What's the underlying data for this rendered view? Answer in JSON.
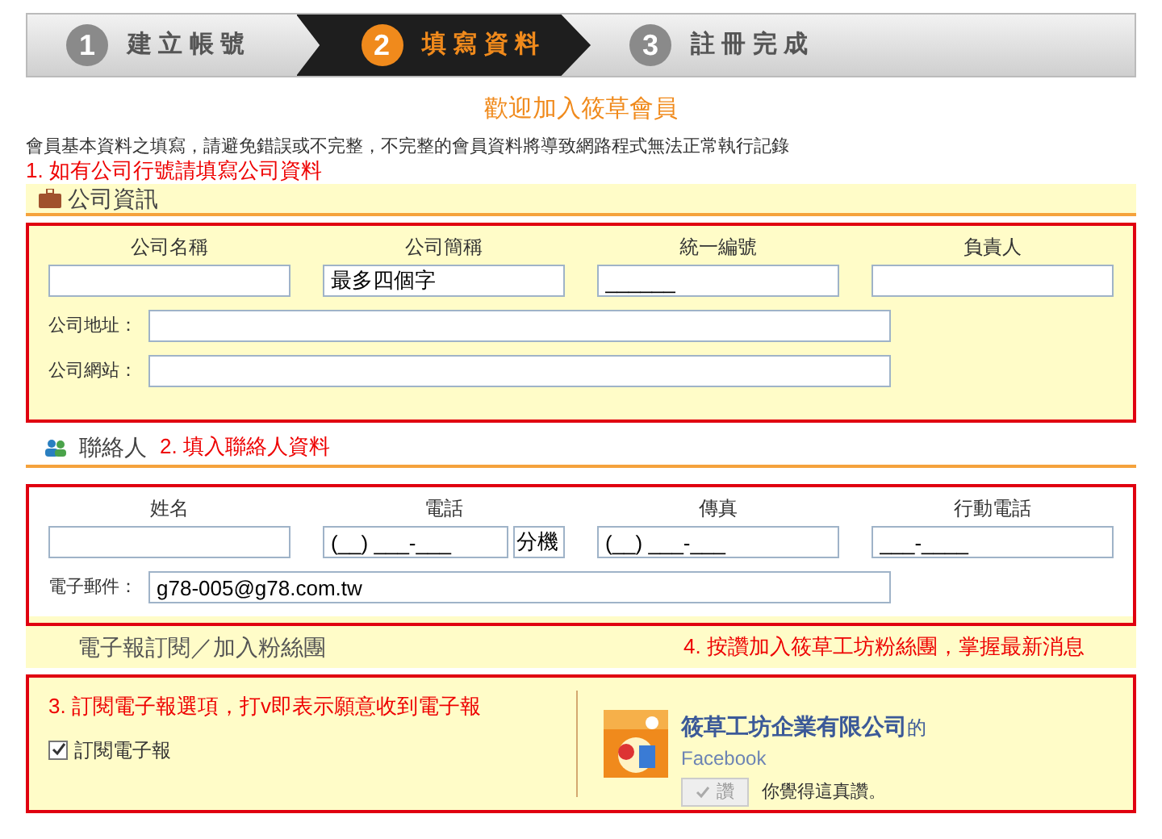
{
  "steps": [
    {
      "number": "1",
      "label": "建 立 帳 號",
      "selected": false
    },
    {
      "number": "2",
      "label": "填 寫 資 料",
      "selected": true
    },
    {
      "number": "3",
      "label": "註 冊 完 成",
      "selected": false
    }
  ],
  "welcome_title": "歡迎加入筱草會員",
  "notice": "會員基本資料之填寫，請避免錯誤或不完整，不完整的會員資料將導致網路程式無法正常執行記錄",
  "company": {
    "annotation": "1. 如有公司行號請填寫公司資料",
    "heading": "公司資訊",
    "columns": [
      {
        "label": "公司名稱"
      },
      {
        "label": "公司簡稱",
        "value": "最多四個字"
      },
      {
        "label": "統一編號",
        "value": "______"
      },
      {
        "label": "負責人"
      }
    ],
    "rows": [
      {
        "label": "公司地址："
      },
      {
        "label": "公司網站："
      }
    ]
  },
  "contact": {
    "heading": "聯絡人",
    "annotation": "2. 填入聯絡人資料",
    "columns": [
      {
        "label": "姓名"
      },
      {
        "label": "電話",
        "value": "(__) ___-___",
        "extension": "分機"
      },
      {
        "label": "傳真",
        "value": "(__) ___-___"
      },
      {
        "label": "行動電話",
        "value": "___-____"
      }
    ],
    "email": {
      "label": "電子郵件：",
      "value": "g78-005@g78.com.tw"
    }
  },
  "newsletter": {
    "heading": "電子報訂閱／加入粉絲團",
    "annotation_fans": "4. 按讚加入筱草工坊粉絲團，掌握最新消息",
    "annotation_subscribe": "3. 訂閱電子報選項，打v即表示願意收到電子報",
    "checkbox": {
      "label": "訂閱電子報",
      "checked": true
    },
    "facebook": {
      "page_name": "筱草工坊企業有限公司",
      "suffix": "的",
      "site": "Facebook",
      "like_button": "讚",
      "like_text": "你覺得這真讚。"
    }
  }
}
